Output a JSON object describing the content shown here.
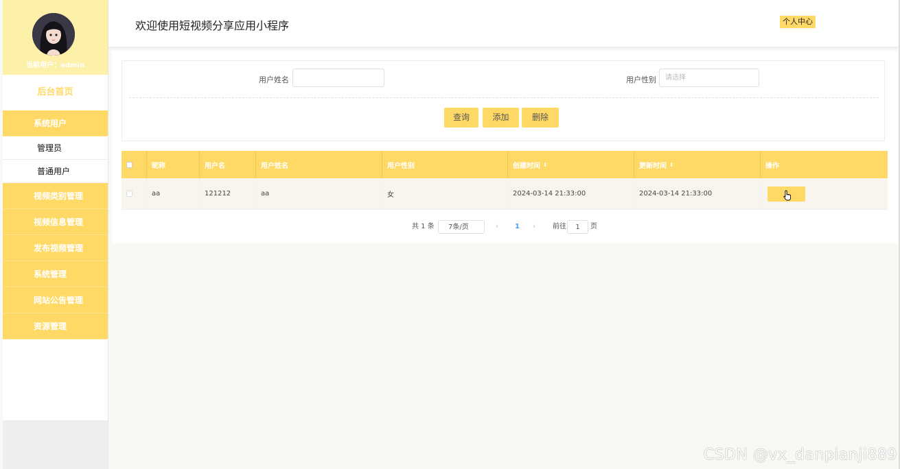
{
  "sidebar": {
    "current_user": "当前用户：admin",
    "home": "后台首页",
    "menu": [
      {
        "label": "系统用户",
        "children": [
          "管理员",
          "普通用户"
        ]
      },
      {
        "label": "视频类别管理"
      },
      {
        "label": "视频信息管理"
      },
      {
        "label": "发布视频管理"
      },
      {
        "label": "系统管理"
      },
      {
        "label": "网站公告管理"
      },
      {
        "label": "资源管理"
      }
    ]
  },
  "header": {
    "title": "欢迎使用短视频分享应用小程序",
    "profile_button": "个人中心"
  },
  "search": {
    "name_label": "用户姓名",
    "name_value": "",
    "gender_label": "用户性别",
    "gender_placeholder": "请选择",
    "query_button": "查询",
    "add_button": "添加",
    "delete_button": "删除"
  },
  "table": {
    "columns": [
      "昵称",
      "用户名",
      "用户姓名",
      "用户性别",
      "创建时间",
      "更新时间",
      "操作"
    ],
    "rows": [
      [
        "aa",
        "121212",
        "aa",
        "女",
        "2024-03-14 21:33:00",
        "2024-03-14 21:33:00"
      ]
    ]
  },
  "pagination": {
    "total": "共 1 条",
    "page_size": "7条/页",
    "current_page": "1",
    "goto_label": "前往",
    "goto_value": "1",
    "page_suffix": "页"
  },
  "watermark": "CSDN @vx_danpianji889",
  "colors": {
    "accent": "#ffd966",
    "profile_bg": "#fdf0a8"
  }
}
